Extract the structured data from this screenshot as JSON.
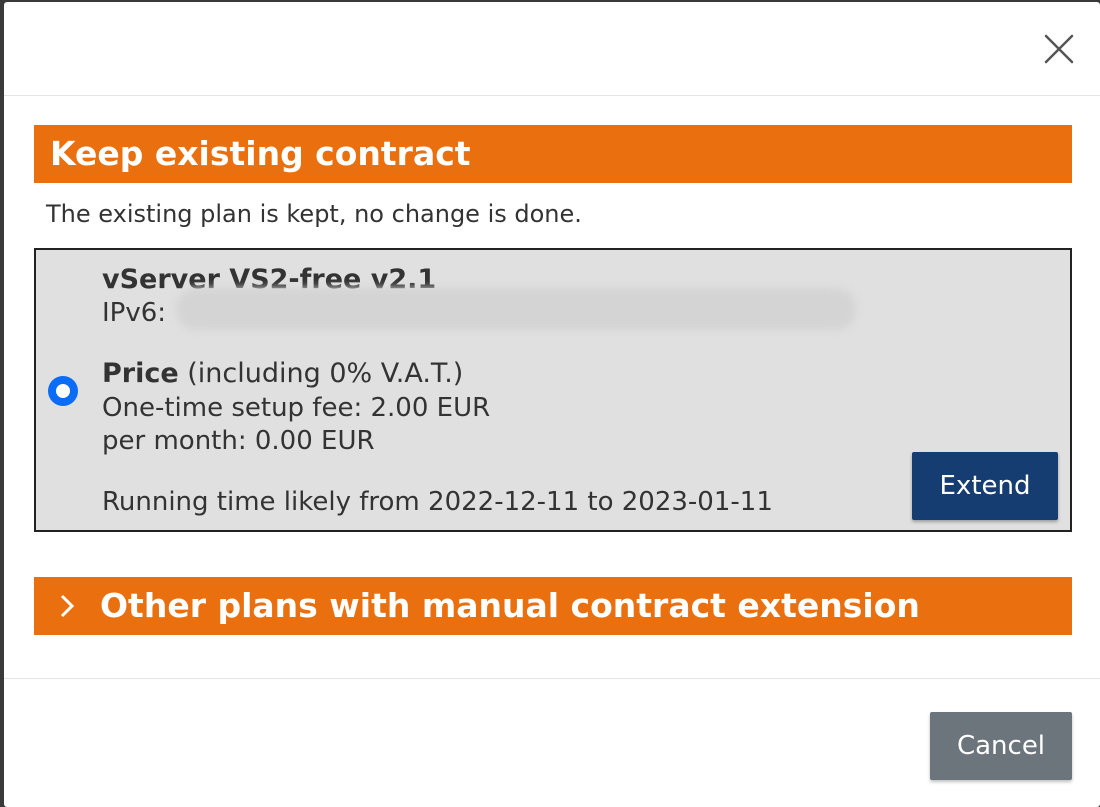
{
  "modal": {
    "close_icon": "close-icon"
  },
  "keep_section": {
    "title": "Keep existing contract",
    "description": "The existing plan is kept, no change is done."
  },
  "plan": {
    "name": "vServer VS2-free v2.1",
    "ipv6_label": "IPv6:",
    "ipv6_value_redacted": true,
    "price_label": "Price",
    "price_note": " (including 0% V.A.T.)",
    "setup_fee": "One-time setup fee: 2.00 EUR",
    "per_month": "per month: 0.00 EUR",
    "running_time": "Running time likely from 2022-12-11 to 2023-01-11",
    "selected": true,
    "extend_label": "Extend"
  },
  "other_section": {
    "title": "Other plans with manual contract extension",
    "icon": "chevron-right-icon"
  },
  "footer": {
    "cancel_label": "Cancel"
  },
  "colors": {
    "accent_orange": "#ea700f",
    "extend_button": "#163d72",
    "cancel_button": "#6c747c",
    "radio": "#0b6cf5",
    "plan_box_bg": "#e0e0e0"
  }
}
